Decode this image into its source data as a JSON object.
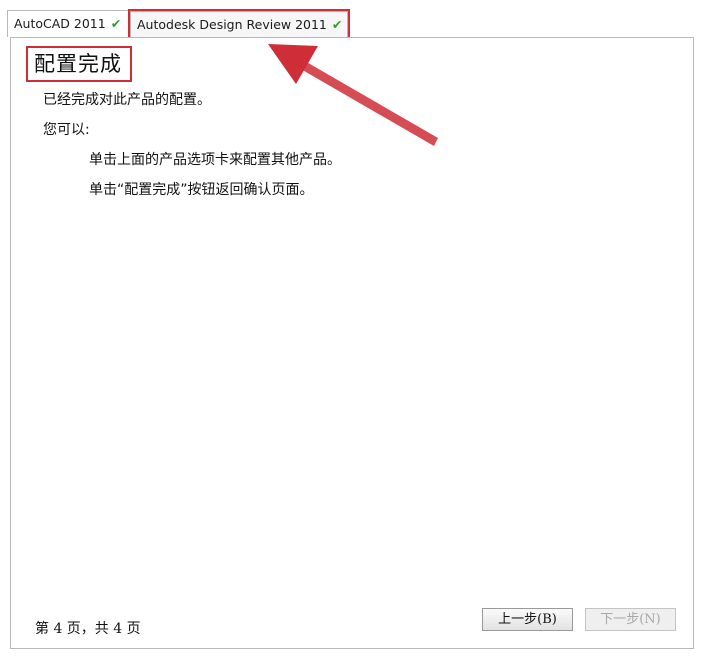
{
  "tabs": [
    {
      "label": "AutoCAD 2011",
      "check": "✔"
    },
    {
      "label": "Autodesk Design Review 2011",
      "check": "✔"
    }
  ],
  "panel": {
    "heading": "配置完成",
    "line1": "已经完成对此产品的配置。",
    "line2": "您可以:",
    "line3": "单击上面的产品选项卡来配置其他产品。",
    "line4": "单击“配置完成”按钮返回确认页面。"
  },
  "footer": {
    "page_indicator": "第 4 页，共 4 页",
    "prev_label": "上一步(B)",
    "next_label": "下一步(N)"
  },
  "colors": {
    "highlight_red": "#cf2d37",
    "check_green": "#2f9e2f"
  }
}
